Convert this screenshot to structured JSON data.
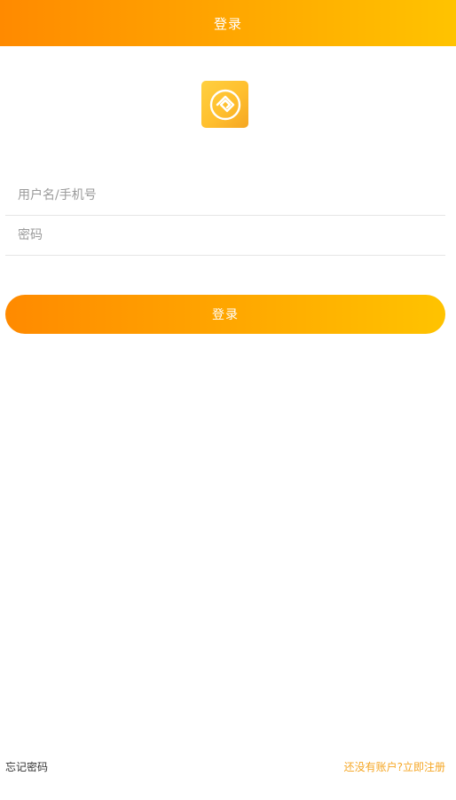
{
  "header": {
    "title": "登录"
  },
  "logo": {
    "icon": "app-logo-icon",
    "color": "#ffc12e"
  },
  "form": {
    "username_placeholder": "用户名/手机号",
    "username_value": "",
    "password_placeholder": "密码",
    "password_value": "",
    "login_label": "登录"
  },
  "footer": {
    "forgot_password": "忘记密码",
    "register_prompt": "还没有账户?立即注册"
  },
  "colors": {
    "accent_start": "#ff8a00",
    "accent_end": "#ffc300",
    "link": "#f5a623"
  }
}
